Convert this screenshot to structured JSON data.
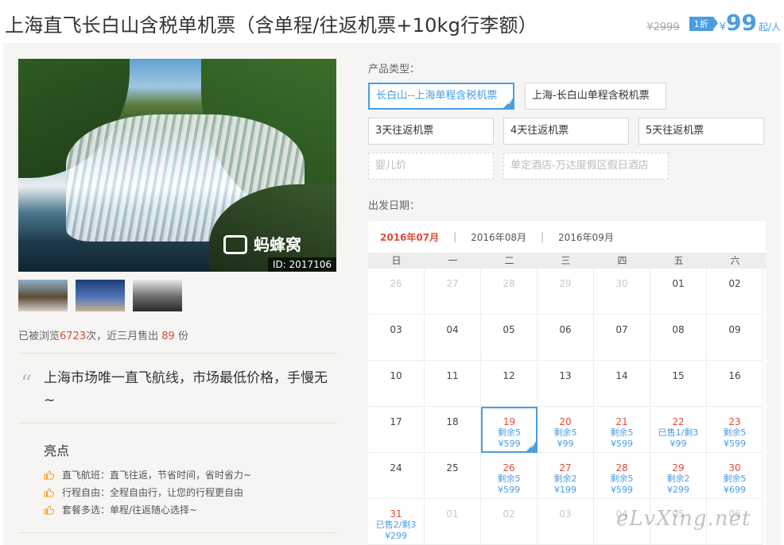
{
  "header": {
    "title": "上海直飞长白山含税单机票（含单程/往返机票+10kg行李额）",
    "original_price": "¥2999",
    "discount_badge": "1折",
    "yen": "¥",
    "price": "99",
    "price_unit": "起/人"
  },
  "gallery": {
    "watermark_logo": "蚂蜂窝",
    "watermark_id": "ID: 2017106",
    "thumbnails": [
      "thumbnail-1",
      "thumbnail-2",
      "thumbnail-3"
    ]
  },
  "stats": {
    "prefix": "已被浏览",
    "views": "6723",
    "mid": "次，近三月售出",
    "sold": "89",
    "suffix": "份"
  },
  "quote": "上海市场唯一直飞航线，市场最低价格，手慢无~",
  "highlights": {
    "title": "亮点",
    "items": [
      "直飞航班：直飞往返，节省时间，省时省力~",
      "行程自由：全程自由行，让您的行程更自由",
      "套餐多选：单程/往返随心选择~"
    ]
  },
  "product_type": {
    "label": "产品类型：",
    "options": [
      {
        "label": "长白山--上海单程含税机票",
        "state": "selected"
      },
      {
        "label": "上海-长白山单程含税机票",
        "state": "normal"
      },
      {
        "label": "3天往返机票",
        "state": "normal"
      },
      {
        "label": "4天往返机票",
        "state": "normal"
      },
      {
        "label": "5天往返机票",
        "state": "normal"
      },
      {
        "label": "婴儿价",
        "state": "disabled"
      },
      {
        "label": "单定酒店-万达度假区假日酒店",
        "state": "disabled"
      }
    ]
  },
  "departure": {
    "label": "出发日期：",
    "months": [
      "2016年07月",
      "2016年08月",
      "2016年09月"
    ],
    "active_month": "2016年07月",
    "weekdays": [
      "日",
      "一",
      "二",
      "三",
      "四",
      "五",
      "六"
    ],
    "weeks": [
      [
        {
          "d": "26",
          "m": true
        },
        {
          "d": "27",
          "m": true
        },
        {
          "d": "28",
          "m": true
        },
        {
          "d": "29",
          "m": true
        },
        {
          "d": "30",
          "m": true
        },
        {
          "d": "01"
        },
        {
          "d": "02"
        }
      ],
      [
        {
          "d": "03"
        },
        {
          "d": "04"
        },
        {
          "d": "05"
        },
        {
          "d": "06"
        },
        {
          "d": "07"
        },
        {
          "d": "08"
        },
        {
          "d": "09"
        }
      ],
      [
        {
          "d": "10"
        },
        {
          "d": "11"
        },
        {
          "d": "12"
        },
        {
          "d": "13"
        },
        {
          "d": "14"
        },
        {
          "d": "15"
        },
        {
          "d": "16"
        }
      ],
      [
        {
          "d": "17"
        },
        {
          "d": "18"
        },
        {
          "d": "19",
          "s1": "剩余5",
          "s2": "¥599",
          "sel": true
        },
        {
          "d": "20",
          "s1": "剩余5",
          "s2": "¥99"
        },
        {
          "d": "21",
          "s1": "剩余5",
          "s2": "¥599"
        },
        {
          "d": "22",
          "s1": "已售1/剩3",
          "s2": "¥99"
        },
        {
          "d": "23",
          "s1": "剩余5",
          "s2": "¥599"
        }
      ],
      [
        {
          "d": "24"
        },
        {
          "d": "25"
        },
        {
          "d": "26",
          "s1": "剩余5",
          "s2": "¥599"
        },
        {
          "d": "27",
          "s1": "剩余2",
          "s2": "¥199"
        },
        {
          "d": "28",
          "s1": "剩余5",
          "s2": "¥599"
        },
        {
          "d": "29",
          "s1": "剩余2",
          "s2": "¥299"
        },
        {
          "d": "30",
          "s1": "剩余5",
          "s2": "¥699"
        }
      ],
      [
        {
          "d": "31",
          "s1": "已售2/剩3",
          "s2": "¥299"
        },
        {
          "d": "01",
          "m": true
        },
        {
          "d": "02",
          "m": true
        },
        {
          "d": "03",
          "m": true
        },
        {
          "d": "04",
          "m": true
        },
        {
          "d": "05",
          "m": true
        },
        {
          "d": "06",
          "m": true
        }
      ]
    ]
  },
  "site_watermark": "eLvXing.net",
  "colors": {
    "accent": "#4a9de3",
    "highlight": "#e04a3a",
    "panel_bg": "#f6f5f3"
  }
}
